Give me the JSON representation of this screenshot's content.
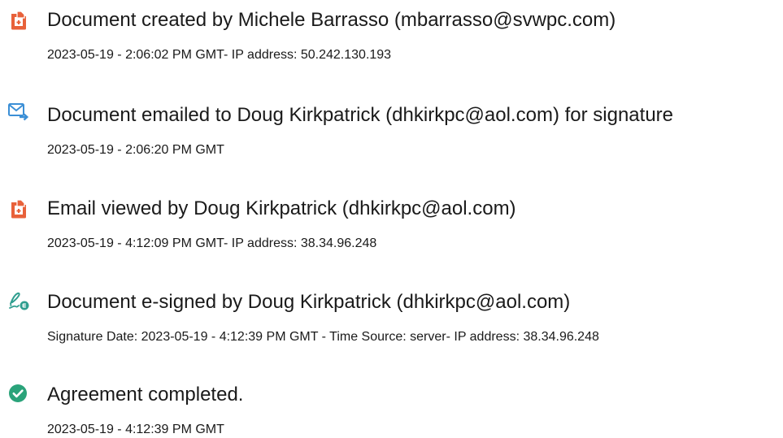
{
  "events": [
    {
      "icon": "document-created-icon",
      "title": "Document created by Michele Barrasso (mbarrasso@svwpc.com)",
      "detail": "2023-05-19 - 2:06:02 PM GMT- IP address: 50.242.130.193"
    },
    {
      "icon": "email-sent-icon",
      "title": "Document emailed to Doug Kirkpatrick (dhkirkpc@aol.com) for signature",
      "detail": "2023-05-19 - 2:06:20 PM GMT"
    },
    {
      "icon": "email-viewed-icon",
      "title": "Email viewed by Doug Kirkpatrick (dhkirkpc@aol.com)",
      "detail": "2023-05-19 - 4:12:09 PM GMT- IP address: 38.34.96.248"
    },
    {
      "icon": "e-sign-pen-icon",
      "title": "Document e-signed by Doug Kirkpatrick (dhkirkpc@aol.com)",
      "detail": "Signature Date: 2023-05-19 - 4:12:39 PM GMT - Time Source: server- IP address: 38.34.96.248"
    },
    {
      "icon": "check-circle-icon",
      "title": "Agreement completed.",
      "detail": "2023-05-19 - 4:12:39 PM GMT"
    }
  ],
  "colors": {
    "document_icon": "#e8613a",
    "email_icon": "#3b8fd6",
    "sign_icon": "#2f9e8f",
    "check_icon": "#2aa37a",
    "text": "#1a1a1a"
  }
}
